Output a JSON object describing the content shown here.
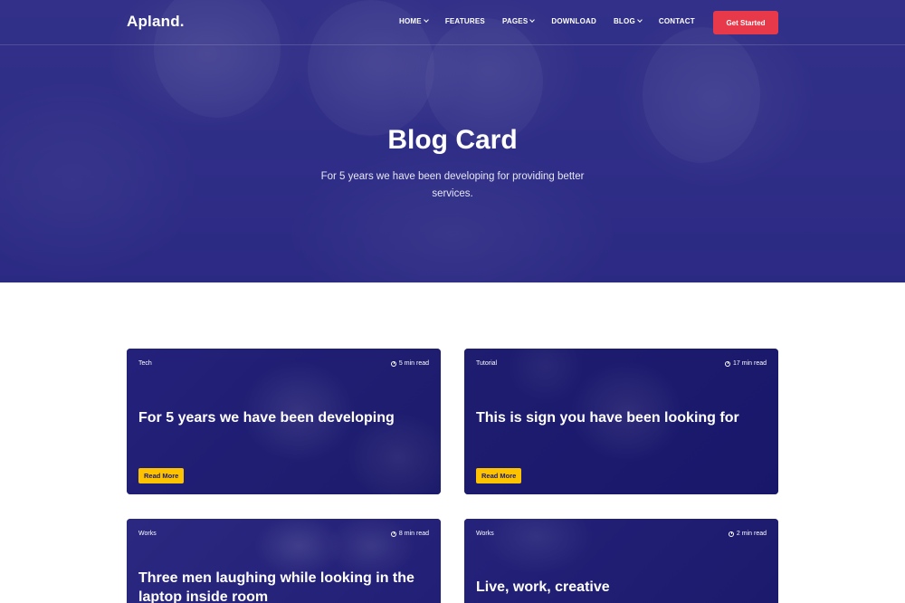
{
  "brand": {
    "logo": "Apland."
  },
  "nav": {
    "items": [
      {
        "label": "HOME",
        "dropdown": true
      },
      {
        "label": "FEATURES",
        "dropdown": false
      },
      {
        "label": "PAGES",
        "dropdown": true
      },
      {
        "label": "DOWNLOAD",
        "dropdown": false
      },
      {
        "label": "BLOG",
        "dropdown": true
      },
      {
        "label": "CONTACT",
        "dropdown": false
      }
    ],
    "cta": "Get Started"
  },
  "hero": {
    "title": "Blog Card",
    "subtitle": "For 5 years we have been developing for providing better services."
  },
  "cards": [
    {
      "tag": "Tech",
      "read_time": "5 min read",
      "title": "For 5 years we have been developing",
      "button": "Read More"
    },
    {
      "tag": "Tutorial",
      "read_time": "17 min read",
      "title": "This is sign you have been looking for",
      "button": "Read More"
    },
    {
      "tag": "Works",
      "read_time": "8 min read",
      "title": "Three men laughing while looking in the laptop inside room"
    },
    {
      "tag": "Works",
      "read_time": "2 min read",
      "title": "Live, work, creative"
    }
  ],
  "colors": {
    "overlay": "#1d1b6b",
    "accent_red": "#e8394a",
    "accent_yellow": "#fdc300"
  },
  "icons": {
    "read_time": "clock-icon",
    "dropdown": "chevron-down-icon"
  }
}
